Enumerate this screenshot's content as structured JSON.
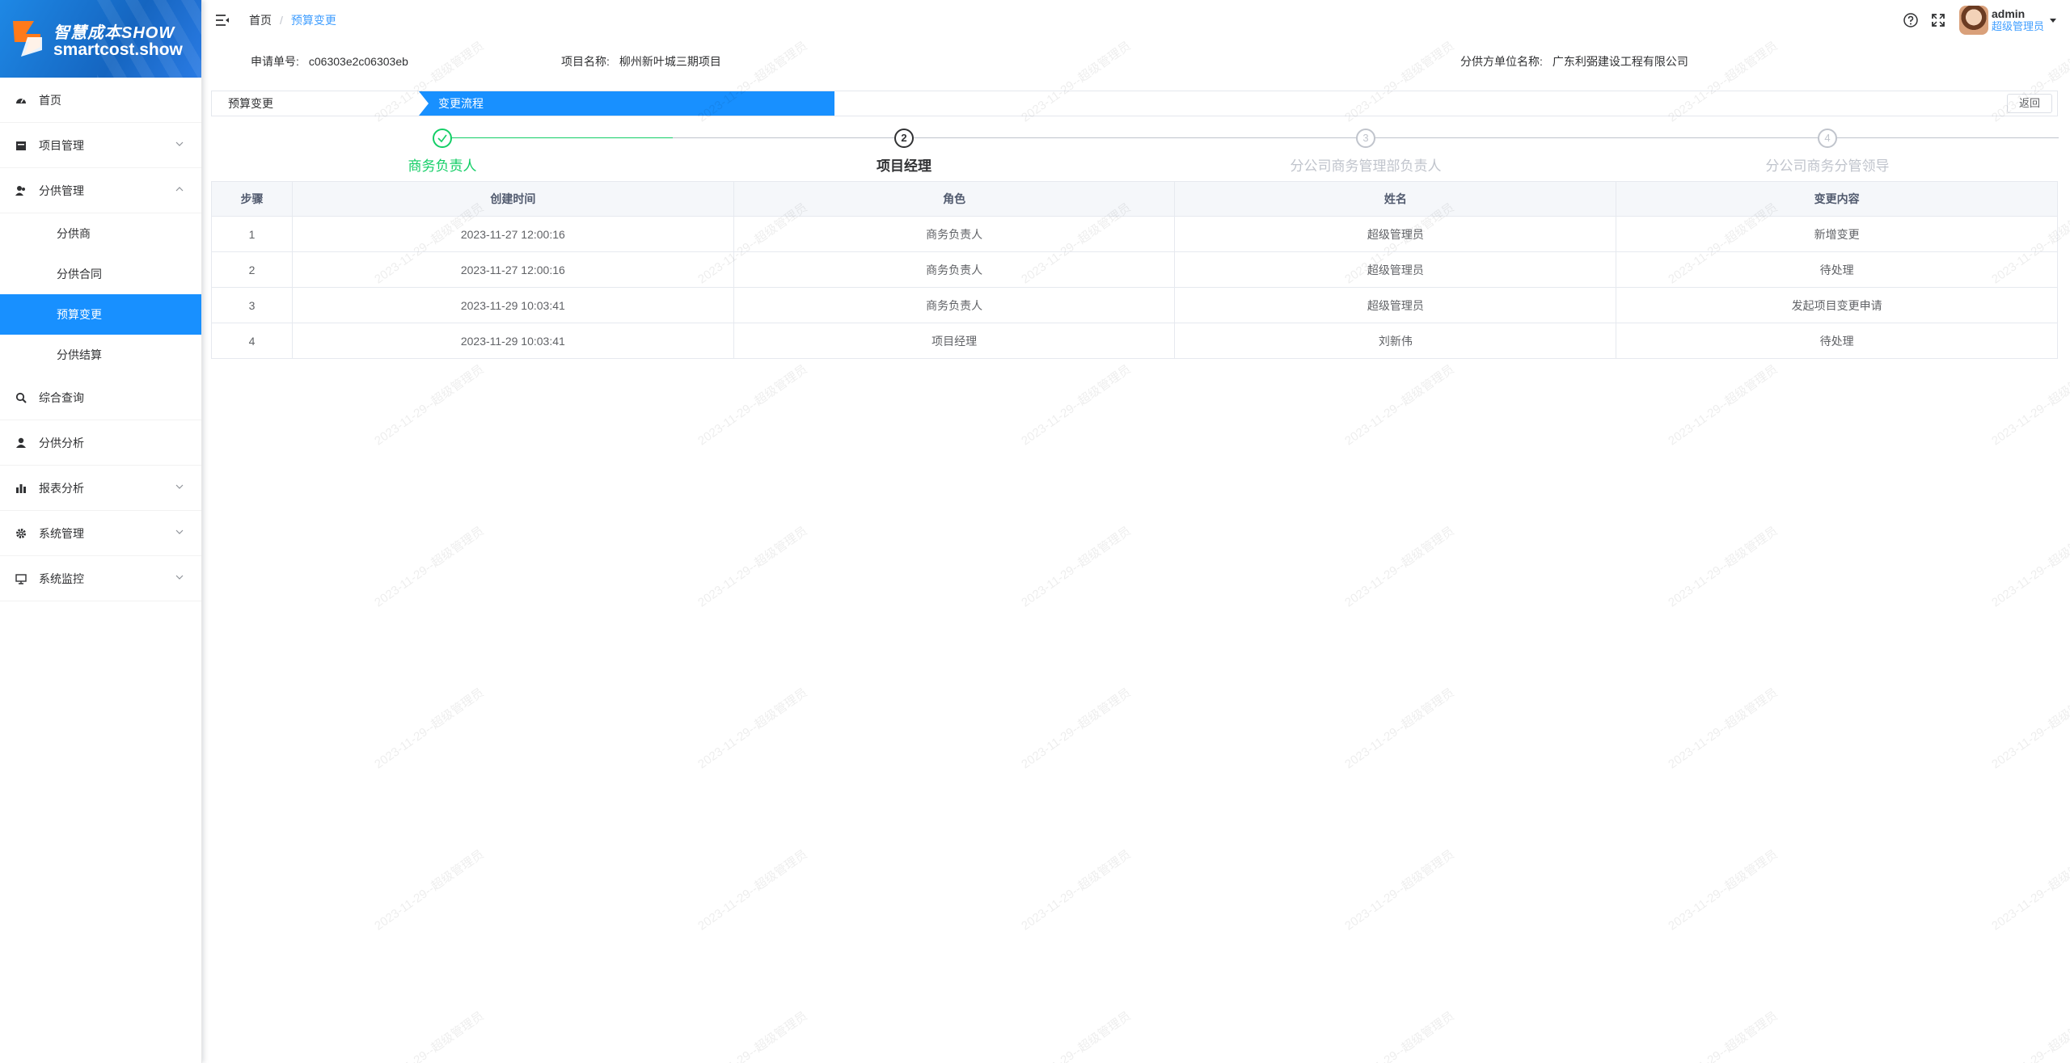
{
  "brand": {
    "title": "智慧成本SHOW",
    "subtitle": "smartcost.show"
  },
  "sidebar": {
    "items": [
      {
        "label": "首页",
        "icon": "dashboard-icon"
      },
      {
        "label": "项目管理",
        "icon": "project-icon",
        "expandable": true
      },
      {
        "label": "分供管理",
        "icon": "supplier-icon",
        "expandable": true,
        "expanded": true,
        "children": [
          {
            "label": "分供商"
          },
          {
            "label": "分供合同"
          },
          {
            "label": "预算变更",
            "active": true
          },
          {
            "label": "分供结算"
          }
        ]
      },
      {
        "label": "综合查询",
        "icon": "search-icon"
      },
      {
        "label": "分供分析",
        "icon": "user-icon"
      },
      {
        "label": "报表分析",
        "icon": "bar-chart-icon",
        "expandable": true
      },
      {
        "label": "系统管理",
        "icon": "gear-icon",
        "expandable": true
      },
      {
        "label": "系统监控",
        "icon": "monitor-icon",
        "expandable": true
      }
    ]
  },
  "header": {
    "breadcrumb": [
      "首页",
      "预算变更"
    ],
    "user": {
      "name": "admin",
      "role": "超级管理员"
    }
  },
  "info": {
    "apply_no_label": "申请单号:",
    "apply_no": "c06303e2c06303eb",
    "project_label": "项目名称:",
    "project": "柳州新叶城三期项目",
    "supplier_label": "分供方单位名称:",
    "supplier": "广东利弼建设工程有限公司"
  },
  "tabs": {
    "left": "预算变更",
    "flow": "变更流程",
    "back": "返回"
  },
  "steps": [
    {
      "index": "1",
      "title": "商务负责人",
      "status": "done"
    },
    {
      "index": "2",
      "title": "项目经理",
      "status": "current"
    },
    {
      "index": "3",
      "title": "分公司商务管理部负责人",
      "status": "wait"
    },
    {
      "index": "4",
      "title": "分公司商务分管领导",
      "status": "wait"
    }
  ],
  "table": {
    "headers": [
      "步骤",
      "创建时间",
      "角色",
      "姓名",
      "变更内容"
    ],
    "rows": [
      [
        "1",
        "2023-11-27 12:00:16",
        "商务负责人",
        "超级管理员",
        "新增变更"
      ],
      [
        "2",
        "2023-11-27 12:00:16",
        "商务负责人",
        "超级管理员",
        "待处理"
      ],
      [
        "3",
        "2023-11-29 10:03:41",
        "商务负责人",
        "超级管理员",
        "发起项目变更申请"
      ],
      [
        "4",
        "2023-11-29 10:03:41",
        "项目经理",
        "刘新伟",
        "待处理"
      ]
    ]
  },
  "watermark": "2023-11-29--超级管理员",
  "colors": {
    "primary": "#1890ff",
    "success": "#13ce66",
    "link": "#409eff"
  }
}
